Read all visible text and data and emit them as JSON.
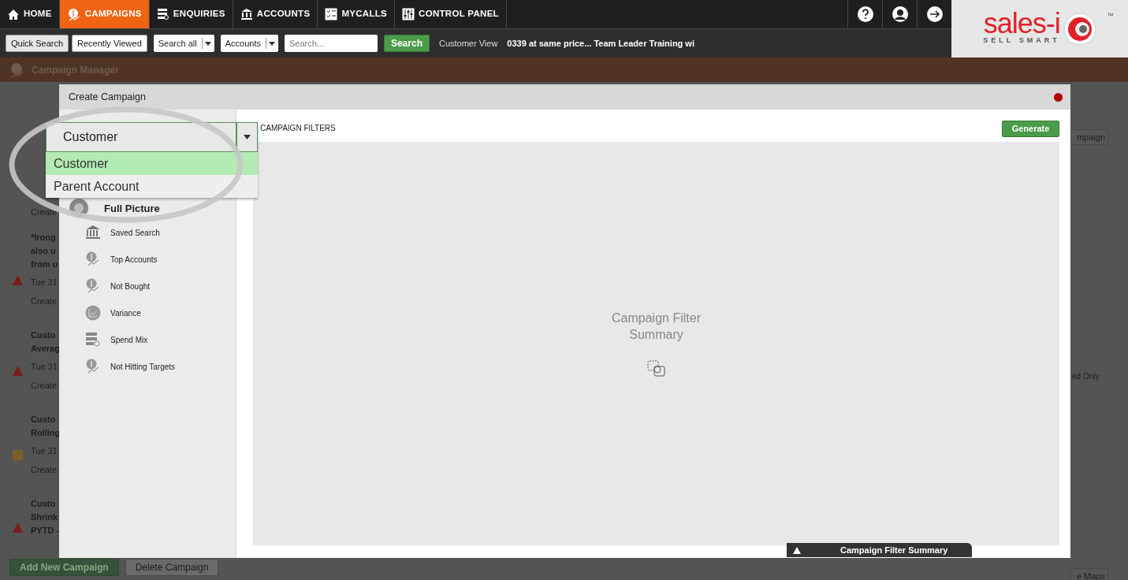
{
  "nav": {
    "tabs": [
      {
        "label": "HOME",
        "kind": "home",
        "selected": false
      },
      {
        "label": "CAMPAIGNS",
        "kind": "campaign",
        "selected": true
      },
      {
        "label": "ENQUIRIES",
        "kind": "enquiry",
        "selected": false
      },
      {
        "label": "ACCOUNTS",
        "kind": "bank",
        "selected": false
      },
      {
        "label": "MYCALLS",
        "kind": "checklist",
        "selected": false
      },
      {
        "label": "CONTROL PANEL",
        "kind": "sliders",
        "selected": false
      }
    ]
  },
  "toolbar": {
    "tabs": [
      {
        "label": "Quick Search",
        "selected": true
      },
      {
        "label": "Recently Viewed",
        "selected": false
      }
    ],
    "selects": [
      "Search all",
      "Accounts"
    ],
    "search": {
      "placeholder": "Search..."
    },
    "search_button": "Search",
    "customer_view_label": "Customer View",
    "recent_items": "0339 at same price... Team Leader Training wi"
  },
  "logo": {
    "name": "sales-i",
    "tagline": "SELL SMART",
    "trademark": "™"
  },
  "page": {
    "title": "Campaign Manager",
    "leading_fragment": "Create",
    "campaigns": [
      {
        "lines": [
          "*Irong",
          "also u",
          "from u"
        ],
        "date": "Tue 31",
        "created": "Create",
        "status": {
          "kind": "triangle",
          "color": "#7a1c1c"
        }
      },
      {
        "lines": [
          "Custo",
          "Averag"
        ],
        "date": "Tue 31",
        "created": "Create",
        "status": {
          "kind": "triangle",
          "color": "#7a1c1c"
        }
      },
      {
        "lines": [
          "Custo",
          "Rolling"
        ],
        "date": "Tue 31",
        "created": "Create",
        "status": {
          "kind": "square",
          "color": "#7a5f2a"
        }
      },
      {
        "lines": [
          "Custo",
          "Shrink",
          "PYTD -"
        ],
        "status": {
          "kind": "triangle",
          "color": "#7a1c1c"
        }
      }
    ],
    "buttons": [
      {
        "label": "Add New Campaign",
        "kind": "primary"
      },
      {
        "label": "Delete Campaign",
        "kind": "secondary"
      }
    ],
    "right_fragments": {
      "top_button": "mpaign",
      "option": "ed Only",
      "bottom_button": "e Maps"
    }
  },
  "modal": {
    "title": "Create Campaign",
    "type_select": {
      "value": "Customer",
      "expanded": true,
      "options": [
        {
          "label": "Customer",
          "selected": true
        },
        {
          "label": "Parent Account",
          "selected": false
        }
      ]
    },
    "filters": [
      {
        "label": "Full Picture",
        "kind": "full"
      },
      {
        "label": "Saved Search",
        "kind": "bank"
      },
      {
        "label": "Top Accounts",
        "kind": "dollar"
      },
      {
        "label": "Not Bought",
        "kind": "dollar"
      },
      {
        "label": "Variance",
        "kind": "chart"
      },
      {
        "label": "Spend Mix",
        "kind": "list"
      },
      {
        "label": "Not Hitting Targets",
        "kind": "dollar"
      }
    ],
    "filters_title": "CAMPAIGN FILTERS",
    "generate_button": "Generate",
    "summary_placeholder": "Campaign Filter Summary",
    "summary_tab": {
      "label": "Campaign Filter Summary",
      "expanded": false
    }
  }
}
